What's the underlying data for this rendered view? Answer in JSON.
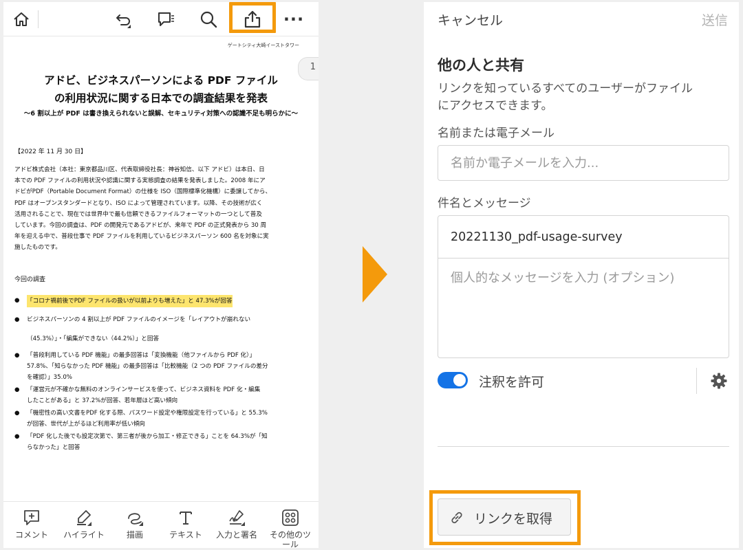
{
  "left": {
    "toolbar": {
      "icons": [
        "home-icon",
        "undo-icon",
        "comments-icon",
        "search-icon",
        "share-icon",
        "more-icon"
      ],
      "more_label": "···"
    },
    "document": {
      "header": "ゲートシティ大崎イーストタワー",
      "page_number": "1",
      "title_line1": "アドビ、ビジネスパーソンによる PDF ファイル",
      "title_line2": "の利用状況に関する日本での調査結果を発表",
      "subtitle": "～6 割以上が PDF は書き換えられないと誤解、セキュリティ対策への認識不足も明らかに～",
      "date": "【2022 年 11 月 30 日】",
      "body_lines": [
        "アドビ株式会社（本社：東京都品川区、代表取締役社長：神谷知信、以下 アドビ）は本日、日",
        "本での PDF ファイルの利用状況や認識に関する実態調査の結果を発表しました。2008 年にア",
        "ドビがPDF（Portable Document Format）の仕様を ISO（国際標準化機構）に委譲してから、",
        "PDF はオープンスタンダードとなり、ISO によって管理されています。以降、その技術が広く",
        "活用されることで、現在では世界中で最も信頼できるファイルフォーマットの一つとして普及",
        "しています。今回の調査は、PDF の開発元であるアドビが、来年で PDF の正式発表から 30 周",
        "年を迎える中で、普段仕事で PDF ファイルを利用しているビジネスパーソン 600 名を対象に実",
        "施したものです。"
      ],
      "survey_heading": "今回の調査",
      "bullet_dot": "●",
      "bullets": [
        {
          "lines": [
            "「コロナ禍前後でPDF ファイルの扱いが以前よりも増えた」と 47.3%が回答"
          ]
        },
        {
          "lines": [
            "ビジネスパーソンの 4 割以上が PDF ファイルのイメージを「レイアウトが崩れない"
          ]
        },
        {
          "lines": [
            "（45.3%）」・「編集ができない（44.2%）」と回答"
          ]
        },
        {
          "lines": [
            "「普段利用している PDF 機能」の最多回答は「変換機能（他ファイルから PDF 化）」",
            "57.8%、「知らなかった PDF 機能」の最多回答は「比較機能（2 つの PDF ファイルの差分",
            "を確認）」35.0%"
          ]
        },
        {
          "lines": [
            "「運営元が不確かな無料のオンラインサービスを使って、ビジネス資料を PDF 化・編集",
            "したことがある」と 37.2%が回答、若年層ほど高い傾向"
          ]
        },
        {
          "lines": [
            "「機密性の高い文書をPDF 化する際、パスワード設定や権限設定を行っている」と 55.3%",
            "が回答、世代が上がるほど利用率が低い傾向"
          ]
        },
        {
          "lines": [
            "「PDF 化した後でも設定次第で、第三者が後から加工・修正できる」ことを 64.3%が「知",
            "らなかった」と回答"
          ]
        }
      ]
    },
    "bottom_tools": [
      {
        "label": "コメント",
        "icon": "comment-add-icon"
      },
      {
        "label": "ハイライト",
        "icon": "highlighter-icon"
      },
      {
        "label": "描画",
        "icon": "draw-icon"
      },
      {
        "label": "テキスト",
        "icon": "text-icon"
      },
      {
        "label": "入力と署名",
        "icon": "fill-sign-icon"
      },
      {
        "label": "その他のツ",
        "label2": "ール",
        "icon": "more-tools-icon"
      }
    ]
  },
  "right": {
    "cancel_label": "キャンセル",
    "send_label": "送信",
    "share_title": "他の人と共有",
    "share_desc_line1": "リンクを知っているすべてのユーザーがファイル",
    "share_desc_line2": "にアクセスできます。",
    "name_label": "名前または電子メール",
    "name_placeholder": "名前か電子メールを入力...",
    "message_label": "件名とメッセージ",
    "subject_value": "20221130_pdf-usage-survey",
    "message_placeholder": "個人的なメッセージを入力 (オプション)",
    "allow_comments_label": "注釈を許可",
    "allow_comments_on": true,
    "get_link_label": "リンクを取得"
  },
  "colors": {
    "highlight_border": "#f49a0c",
    "toggle_on": "#1473e6",
    "text_highlight": "#fde56e"
  }
}
